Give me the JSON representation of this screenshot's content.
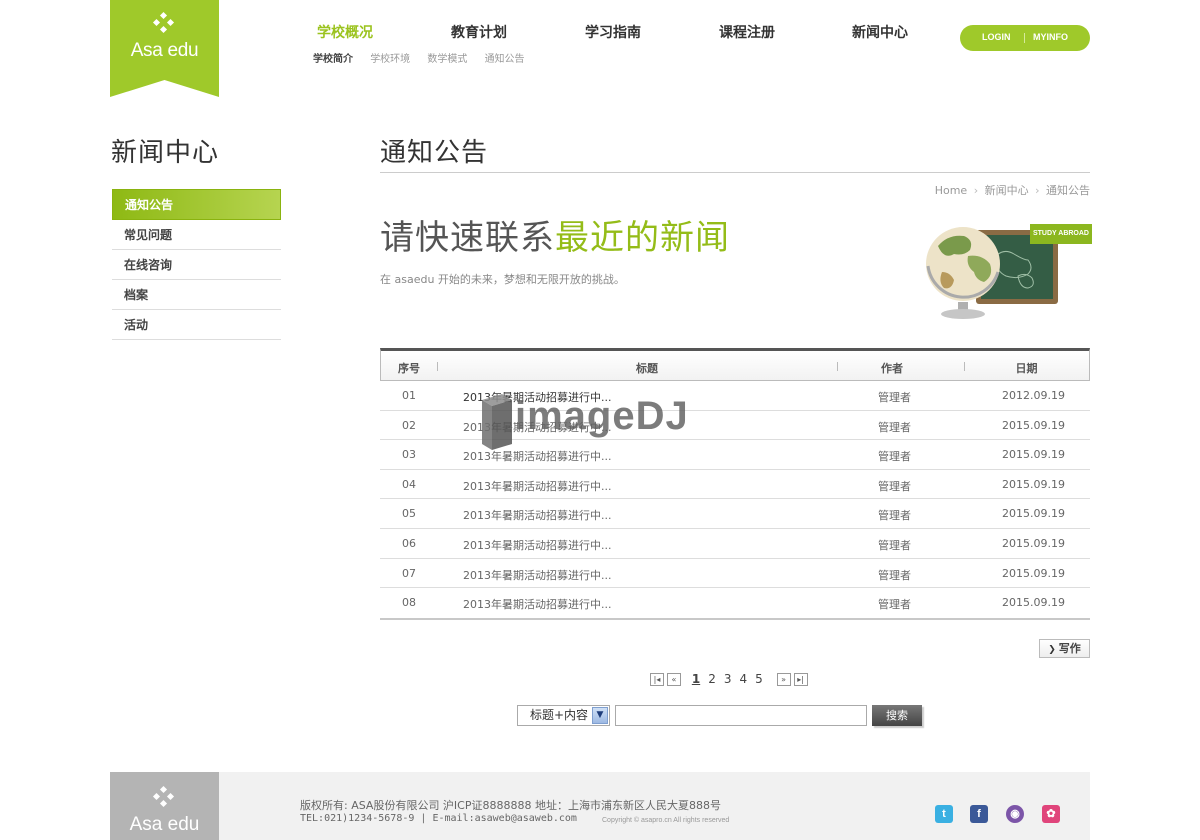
{
  "logo": {
    "text": "Asa edu",
    "color": "#9fc92a"
  },
  "nav": {
    "items": [
      {
        "label": "学校概况",
        "active": true
      },
      {
        "label": "教育计划"
      },
      {
        "label": "学习指南"
      },
      {
        "label": "课程注册"
      },
      {
        "label": "新闻中心"
      }
    ],
    "sub": [
      {
        "label": "学校简介",
        "active": true
      },
      {
        "label": "学校环境"
      },
      {
        "label": "数学模式"
      },
      {
        "label": "通知公告"
      }
    ]
  },
  "account": {
    "login": "LOGIN",
    "myinfo": "MYINFO"
  },
  "sidebar": {
    "title": "新闻中心",
    "items": [
      {
        "label": "通知公告",
        "active": true
      },
      {
        "label": "常见问题"
      },
      {
        "label": "在线咨询"
      },
      {
        "label": "档案"
      },
      {
        "label": "活动"
      }
    ]
  },
  "content": {
    "title": "通知公告",
    "breadcrumb": [
      "Home",
      "新闻中心",
      "通知公告"
    ],
    "hero_plain": "请快速联系",
    "hero_accent": "最近的新闻",
    "hero_sub": "在 asaedu 开始的未来，梦想和无限开放的挑战。",
    "hero_tag": "STUDY ABROAD"
  },
  "table": {
    "headers": [
      "序号",
      "标题",
      "作者",
      "日期"
    ],
    "rows": [
      {
        "no": "01",
        "title": "2013年暑期活动招募进行中...",
        "author": "管理者",
        "date": "2012.09.19"
      },
      {
        "no": "02",
        "title": "2013年暑期活动招募进行中...",
        "author": "管理者",
        "date": "2015.09.19"
      },
      {
        "no": "03",
        "title": "2013年暑期活动招募进行中...",
        "author": "管理者",
        "date": "2015.09.19"
      },
      {
        "no": "04",
        "title": "2013年暑期活动招募进行中...",
        "author": "管理者",
        "date": "2015.09.19"
      },
      {
        "no": "05",
        "title": "2013年暑期活动招募进行中...",
        "author": "管理者",
        "date": "2015.09.19"
      },
      {
        "no": "06",
        "title": "2013年暑期活动招募进行中...",
        "author": "管理者",
        "date": "2015.09.19"
      },
      {
        "no": "07",
        "title": "2013年暑期活动招募进行中...",
        "author": "管理者",
        "date": "2015.09.19"
      },
      {
        "no": "08",
        "title": "2013年暑期活动招募进行中...",
        "author": "管理者",
        "date": "2015.09.19"
      }
    ]
  },
  "write_label": "写作",
  "pager": {
    "pages": [
      "1",
      "2",
      "3",
      "4",
      "5"
    ],
    "current": "1"
  },
  "search": {
    "select_value": "标题+内容",
    "input_value": "",
    "button": "搜索"
  },
  "footer": {
    "logo_text": "Asa edu",
    "line1": "版权所有: ASA股份有限公司 沪ICP证8888888 地址：上海市浦东新区人民大夏888号",
    "line2": "TEL:021)1234-5678-9 | E-mail:asaweb@asaweb.com",
    "copyright": "Copyright © asapro.cn All rights reserved"
  },
  "social": [
    {
      "icon": "twitter-icon",
      "color": "#3ab0e2"
    },
    {
      "icon": "facebook-icon",
      "color": "#3b5998"
    },
    {
      "icon": "chat-icon",
      "color": "#7c55a8"
    },
    {
      "icon": "blog-icon",
      "color": "#e0457b"
    }
  ],
  "watermark": "imageDJ"
}
